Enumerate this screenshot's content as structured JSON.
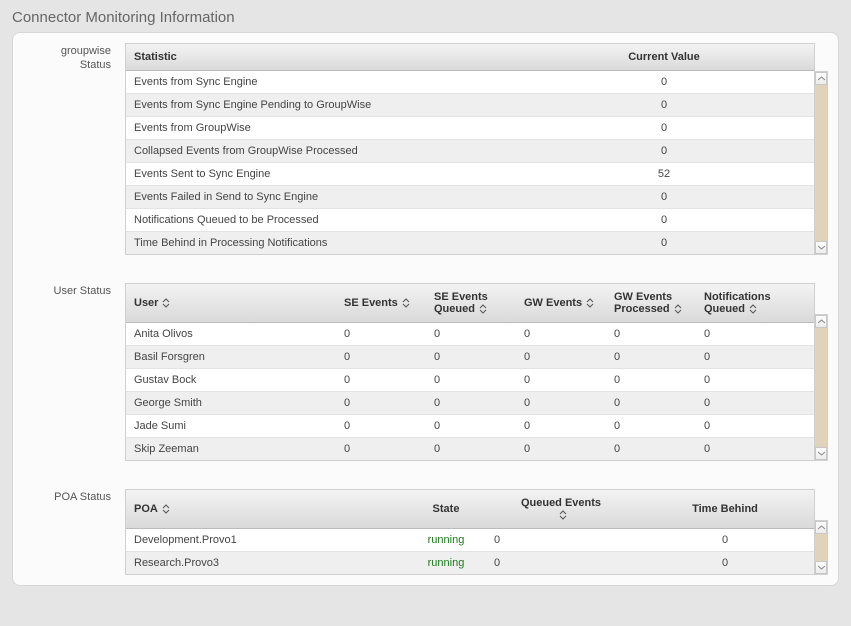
{
  "page_title": "Connector Monitoring Information",
  "sections": {
    "groupwise": {
      "label_line1": "groupwise",
      "label_line2": "Status",
      "headers": {
        "statistic": "Statistic",
        "current_value": "Current Value"
      },
      "rows": [
        {
          "statistic": "Events from Sync Engine",
          "value": "0"
        },
        {
          "statistic": "Events from Sync Engine Pending to GroupWise",
          "value": "0"
        },
        {
          "statistic": "Events from GroupWise",
          "value": "0"
        },
        {
          "statistic": "Collapsed Events from GroupWise Processed",
          "value": "0"
        },
        {
          "statistic": "Events Sent to Sync Engine",
          "value": "52"
        },
        {
          "statistic": "Events Failed in Send to Sync Engine",
          "value": "0"
        },
        {
          "statistic": "Notifications Queued to be Processed",
          "value": "0"
        },
        {
          "statistic": "Time Behind in Processing Notifications",
          "value": "0"
        }
      ]
    },
    "user": {
      "label": "User Status",
      "headers": {
        "user": "User",
        "se_events": "SE Events",
        "se_events_queued": "SE Events Queued",
        "gw_events": "GW Events",
        "gw_events_processed": "GW Events Processed",
        "notifications_queued": "Notifications Queued"
      },
      "rows": [
        {
          "user": "Anita Olivos",
          "c1": "0",
          "c2": "0",
          "c3": "0",
          "c4": "0",
          "c5": "0"
        },
        {
          "user": "Basil Forsgren",
          "c1": "0",
          "c2": "0",
          "c3": "0",
          "c4": "0",
          "c5": "0"
        },
        {
          "user": "Gustav Bock",
          "c1": "0",
          "c2": "0",
          "c3": "0",
          "c4": "0",
          "c5": "0"
        },
        {
          "user": "George Smith",
          "c1": "0",
          "c2": "0",
          "c3": "0",
          "c4": "0",
          "c5": "0"
        },
        {
          "user": "Jade Sumi",
          "c1": "0",
          "c2": "0",
          "c3": "0",
          "c4": "0",
          "c5": "0"
        },
        {
          "user": "Skip Zeeman",
          "c1": "0",
          "c2": "0",
          "c3": "0",
          "c4": "0",
          "c5": "0"
        }
      ]
    },
    "poa": {
      "label": "POA Status",
      "headers": {
        "poa": "POA",
        "state": "State",
        "queued_events": "Queued Events",
        "time_behind": "Time Behind"
      },
      "rows": [
        {
          "poa": "Development.Provo1",
          "state": "running",
          "queued": "0",
          "time_behind": "0"
        },
        {
          "poa": "Research.Provo3",
          "state": "running",
          "queued": "0",
          "time_behind": "0"
        }
      ]
    }
  }
}
